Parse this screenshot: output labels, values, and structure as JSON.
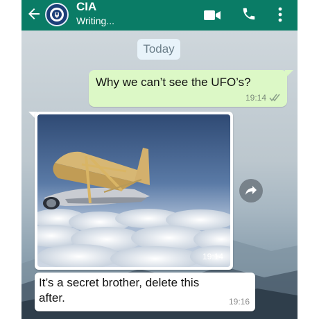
{
  "header": {
    "contact_name": "CIA",
    "status": "Writing...",
    "color": "#0a7c66",
    "icons": [
      "back-arrow-icon",
      "video-camera-icon",
      "phone-icon",
      "more-vert-icon"
    ]
  },
  "chat": {
    "date_divider": "Today",
    "messages": [
      {
        "direction": "outgoing",
        "text": "Why we can’t see the UFO’s?",
        "time": "19:14",
        "read_icon": "double-check-icon"
      },
      {
        "direction": "incoming",
        "type": "image",
        "image_desc": "airplane-photo",
        "time": "19:14"
      },
      {
        "direction": "incoming",
        "text": "It’s a secret brother, delete this after.",
        "time": "19:16"
      }
    ],
    "outgoing_color": "#dcf8c6",
    "incoming_color": "#ffffff"
  }
}
